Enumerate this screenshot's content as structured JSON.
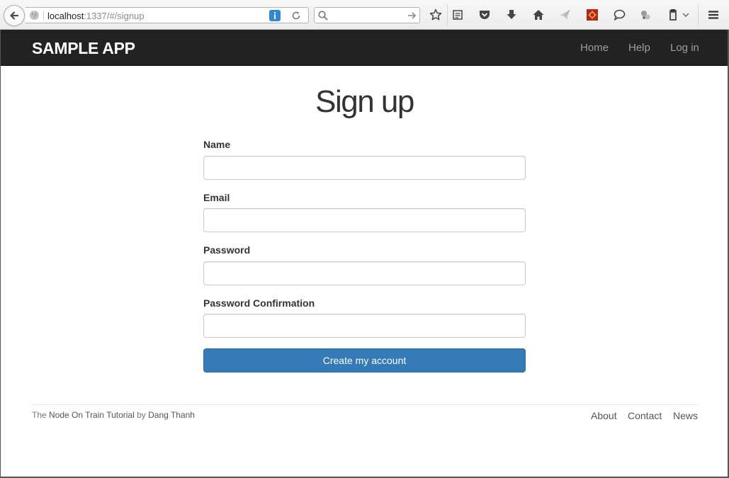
{
  "browser": {
    "url_host": "localhost",
    "url_rest": ":1337/#/signup",
    "search_placeholder": "",
    "toolbar_icons": [
      "bookmark-star-icon",
      "reading-list-icon",
      "pocket-icon",
      "downloads-icon",
      "home-icon",
      "send-icon",
      "extension-icon",
      "chat-icon",
      "sync-icon",
      "clipboard-icon",
      "menu-icon"
    ]
  },
  "navbar": {
    "brand": "SAMPLE APP",
    "links": [
      "Home",
      "Help",
      "Log in"
    ]
  },
  "main": {
    "title": "Sign up",
    "fields": [
      {
        "label": "Name",
        "value": ""
      },
      {
        "label": "Email",
        "value": ""
      },
      {
        "label": "Password",
        "value": ""
      },
      {
        "label": "Password Confirmation",
        "value": ""
      }
    ],
    "submit_label": "Create my account"
  },
  "footer": {
    "prefix": "The",
    "tutorial_link": "Node On Train Tutorial",
    "by": "by",
    "author_link": "Dang Thanh",
    "links": [
      "About",
      "Contact",
      "News"
    ]
  },
  "colors": {
    "navbar_bg": "#222222",
    "primary_button": "#337ab7"
  }
}
